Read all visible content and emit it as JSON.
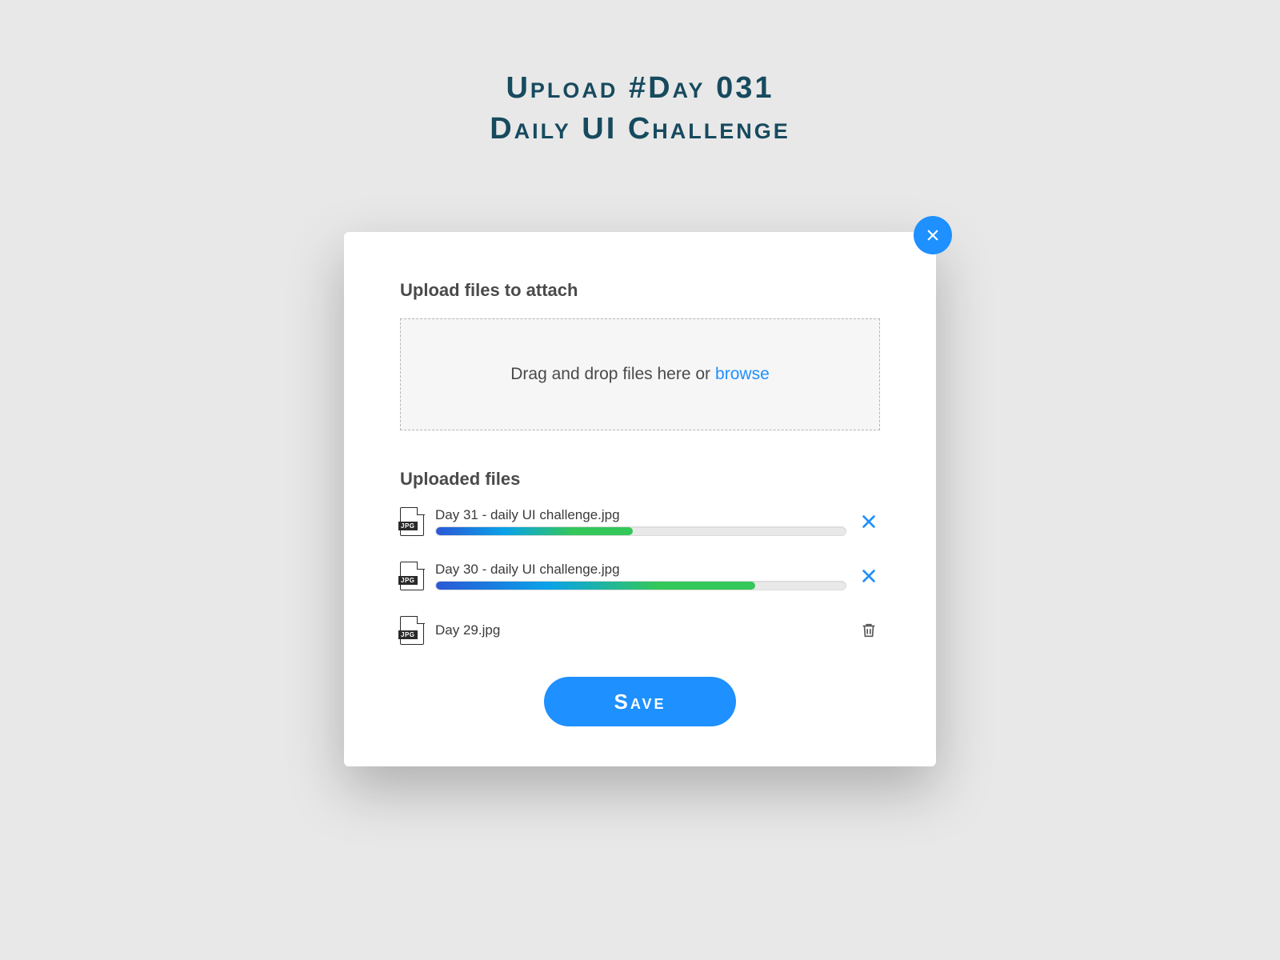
{
  "header": {
    "line1": "Upload #Day 031",
    "line2": "Daily UI Challenge"
  },
  "modal": {
    "upload_title": "Upload files to attach",
    "dropzone_text": "Drag and drop files here or",
    "browse_label": "browse",
    "uploaded_title": "Uploaded files",
    "save_label": "Save",
    "file_badge": "JPG"
  },
  "files": [
    {
      "name": "Day 31 - daily UI challenge.jpg",
      "progress": 48,
      "action": "cancel"
    },
    {
      "name": "Day 30 - daily UI challenge.jpg",
      "progress": 78,
      "action": "cancel"
    },
    {
      "name": "Day 29.jpg",
      "progress": 100,
      "action": "delete"
    }
  ],
  "colors": {
    "accent": "#1e90ff",
    "heading": "#174a5e"
  }
}
